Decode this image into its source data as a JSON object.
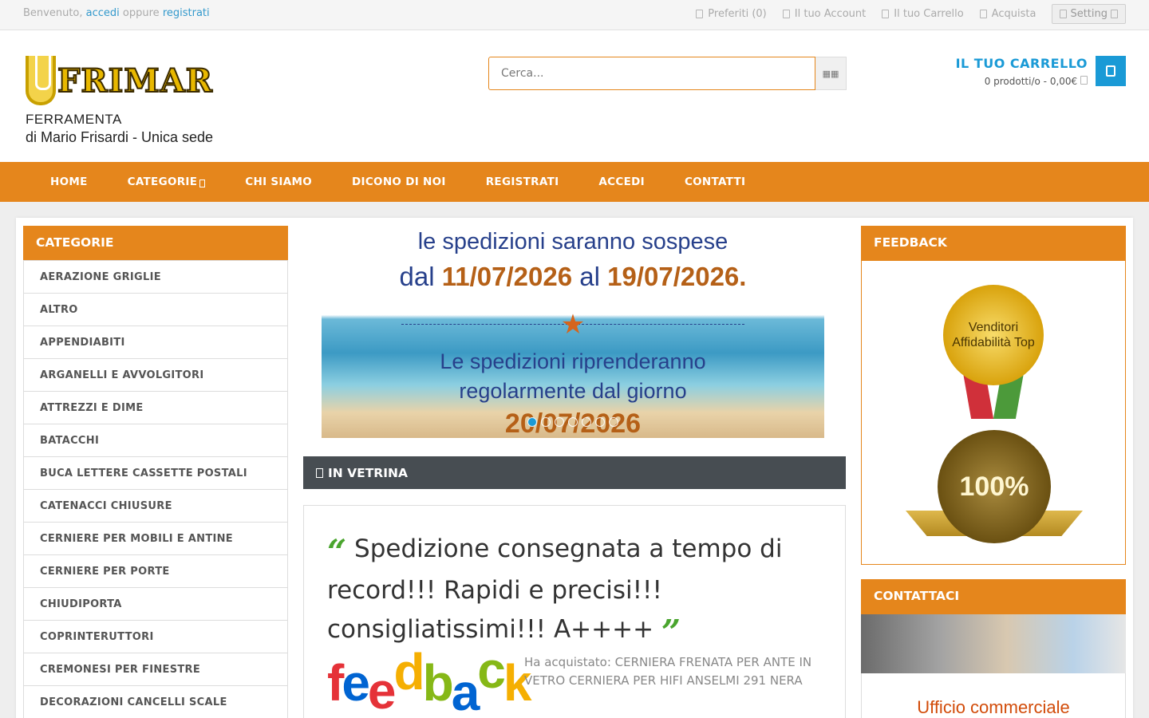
{
  "topbar": {
    "welcome_prefix": "Benvenuto,",
    "login_link": "accedi",
    "or_text": "oppure",
    "register_link": "registrati",
    "links": [
      {
        "label": "Preferiti (0)",
        "icon": "heart-icon"
      },
      {
        "label": "Il tuo Account",
        "icon": "user-icon"
      },
      {
        "label": "Il tuo Carrello",
        "icon": "cart-icon"
      },
      {
        "label": "Acquista",
        "icon": "share-icon"
      }
    ],
    "setting_label": "Setting"
  },
  "logo": {
    "brand": "FRIMAR",
    "line1": "FERRAMENTA",
    "line2": "di Mario Frisardi - Unica sede"
  },
  "search": {
    "placeholder": "Cerca...",
    "button_icon": "search-icon"
  },
  "cart": {
    "title": "IL TUO CARRELLO",
    "summary": "0 prodotti/o - 0,00€",
    "button_icon": "shopping-cart-icon"
  },
  "nav": {
    "items": [
      "HOME",
      "CATEGORIE",
      "CHI SIAMO",
      "DICONO DI NOI",
      "REGISTRATI",
      "ACCEDI",
      "CONTATTI"
    ]
  },
  "categories": {
    "title": "CATEGORIE",
    "items": [
      "AERAZIONE GRIGLIE",
      "ALTRO",
      "APPENDIABITI",
      "ARGANELLI E AVVOLGITORI",
      "ATTREZZI E DIME",
      "BATACCHI",
      "BUCA LETTERE CASSETTE POSTALI",
      "CATENACCI CHIUSURE",
      "CERNIERE PER MOBILI E ANTINE",
      "CERNIERE PER PORTE",
      "CHIUDIPORTA",
      "COPRINTERUTTORI",
      "CREMONESI PER FINESTRE",
      "DECORAZIONI CANCELLI SCALE"
    ]
  },
  "slider": {
    "line1": "le spedizioni saranno sospese",
    "line2_pre": "dal",
    "date_from": "11/07/2026",
    "line2_mid": "al",
    "date_to": "19/07/2026.",
    "line3a": "Le spedizioni riprenderanno",
    "line3b": "regolarmente dal giorno",
    "line4": "20/07/2026",
    "dots": 7,
    "active_dot": 0
  },
  "vetrina": {
    "title": "IN VETRINA"
  },
  "review": {
    "open_quote": "“",
    "text": "Spedizione consegnata a tempo di record!!! Rapidi e precisi!!! consigliatissimi!!! A++++",
    "close_quote": "”",
    "logo_word": "feedback",
    "bought": "Ha acquistato: CERNIERA FRENATA PER ANTE IN VETRO CERNIERA PER HIFI ANSELMI 291 NERA"
  },
  "feedback": {
    "title": "FEEDBACK",
    "medal1_text": "Venditori Affidabilità Top",
    "medal2_text": "100%"
  },
  "contatti": {
    "title": "CONTATTACI",
    "caption": "Ufficio commerciale"
  },
  "colors": {
    "orange": "#e5861c",
    "blue": "#1a9ad6",
    "dark": "#474d52"
  }
}
